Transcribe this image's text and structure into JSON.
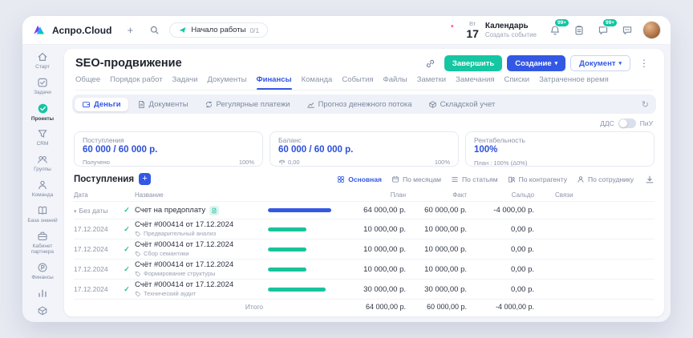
{
  "icons": {
    "plus": "+",
    "chevron": "▾",
    "dots": "⋮",
    "check": "✓",
    "caret": "▾",
    "refresh": "↻"
  },
  "topbar": {
    "brand": "Аспро.Cloud",
    "onboarding_label": "Начало работы",
    "onboarding_progress": "0/1",
    "weekday": "Вт",
    "day": "17",
    "calendar_title": "Календарь",
    "calendar_subtitle": "Создать событие",
    "notifications_badge": "99+",
    "chat_badge": "99+"
  },
  "sidebar": {
    "items": [
      {
        "label": "Старт"
      },
      {
        "label": "Задачи"
      },
      {
        "label": "Проекты"
      },
      {
        "label": "CRM"
      },
      {
        "label": "Группы"
      },
      {
        "label": "Команда"
      },
      {
        "label": "База знаний"
      },
      {
        "label": "Кабинет партнера"
      },
      {
        "label": "Финансы"
      }
    ]
  },
  "page": {
    "title": "SEO-продвижение",
    "tabs": [
      {
        "label": "Общее"
      },
      {
        "label": "Порядок работ"
      },
      {
        "label": "Задачи"
      },
      {
        "label": "Документы"
      },
      {
        "label": "Финансы"
      },
      {
        "label": "Команда"
      },
      {
        "label": "События"
      },
      {
        "label": "Файлы"
      },
      {
        "label": "Заметки"
      },
      {
        "label": "Замечания"
      },
      {
        "label": "Списки"
      },
      {
        "label": "Затраченное время"
      }
    ],
    "finish_button": "Завершить",
    "create_button": "Создание",
    "document_button": "Документ"
  },
  "subtabs": [
    {
      "label": "Деньги"
    },
    {
      "label": "Документы"
    },
    {
      "label": "Регулярные платежи"
    },
    {
      "label": "Прогноз денежного потока"
    },
    {
      "label": "Складской учет"
    }
  ],
  "mode_toggle": {
    "left": "ДДС",
    "right": "ПиУ"
  },
  "stat_cards": {
    "receipts": {
      "title": "Поступления",
      "value": "60 000 / 60 000 р.",
      "footer_left": "Получено",
      "footer_right": "100%",
      "progress_pct": 100,
      "bar_color": "#3358e4"
    },
    "balance": {
      "title": "Баланс",
      "value": "60 000 / 60 000 р.",
      "footer_left": "0,00",
      "footer_right": "100%",
      "progress_pct": 100,
      "bar_color": "#3358e4"
    },
    "profitability": {
      "title": "Рентабельность",
      "value": "100%",
      "footer_left": "План : 100% (Δ0%)"
    }
  },
  "section": {
    "title": "Поступления"
  },
  "views": [
    {
      "label": "Основная"
    },
    {
      "label": "По месяцам"
    },
    {
      "label": "По статьям"
    },
    {
      "label": "По контрагенту"
    },
    {
      "label": "По сотруднику"
    }
  ],
  "table": {
    "columns": [
      "Дата",
      "Название",
      "План",
      "Факт",
      "Сальдо",
      "Связи"
    ],
    "group": {
      "date": "Без даты",
      "name": "Счет на предоплату",
      "plan": "64 000,00 р.",
      "fact": "60 000,00 р.",
      "saldo": "-4 000,00 р.",
      "bar_pct": 92,
      "bar_color": "#3358e4"
    },
    "rows": [
      {
        "date": "17.12.2024",
        "name": "Счёт #000414 от 17.12.2024",
        "sub": "Предварительный анализ",
        "plan": "10 000,00 р.",
        "fact": "10 000,00 р.",
        "saldo": "0,00 р.",
        "bar_pct": 56,
        "bar_color": "#19c39c"
      },
      {
        "date": "17.12.2024",
        "name": "Счёт #000414 от 17.12.2024",
        "sub": "Сбор семантики",
        "plan": "10 000,00 р.",
        "fact": "10 000,00 р.",
        "saldo": "0,00 р.",
        "bar_pct": 56,
        "bar_color": "#19c39c"
      },
      {
        "date": "17.12.2024",
        "name": "Счёт #000414 от 17.12.2024",
        "sub": "Формирование структуры",
        "plan": "10 000,00 р.",
        "fact": "10 000,00 р.",
        "saldo": "0,00 р.",
        "bar_pct": 56,
        "bar_color": "#19c39c"
      },
      {
        "date": "17.12.2024",
        "name": "Счёт #000414 от 17.12.2024",
        "sub": "Технический аудит",
        "plan": "30 000,00 р.",
        "fact": "30 000,00 р.",
        "saldo": "0,00 р.",
        "bar_pct": 84,
        "bar_color": "#19c39c"
      }
    ],
    "total": {
      "label": "Итого",
      "plan": "64 000,00 р.",
      "fact": "60 000,00 р.",
      "saldo": "-4 000,00 р."
    }
  }
}
